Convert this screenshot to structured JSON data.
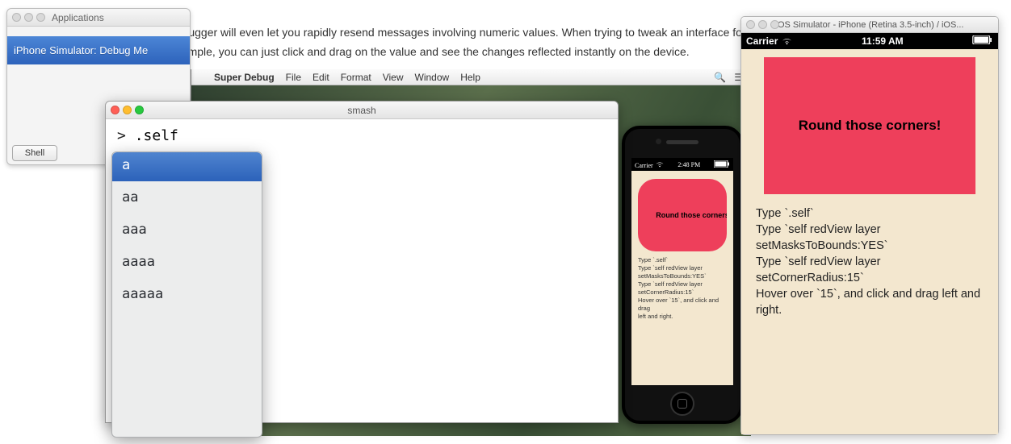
{
  "article": {
    "line1": "debugger will even let you rapidly resend messages involving numeric values. When trying to tweak an interface for",
    "line2": "example, you can just click and drag on the value and see the changes reflected instantly on the device."
  },
  "apps_window": {
    "title": "Applications",
    "selected_item": "iPhone Simulator: Debug Me",
    "shell_button": "Shell"
  },
  "mac_menubar": {
    "app": "Super Debug",
    "items": [
      "File",
      "Edit",
      "Format",
      "View",
      "Window",
      "Help"
    ]
  },
  "smash_window": {
    "title": "smash",
    "prompt_prefix": ">",
    "prompt_text": ".self"
  },
  "autocomplete": {
    "items": [
      "a",
      "aa",
      "aaa",
      "aaaa",
      "aaaaa"
    ]
  },
  "iphone_small": {
    "status_left": "Carrier",
    "status_center": "2:48 PM",
    "red_text": "Round those corners!",
    "instr": [
      "Type `.self`",
      "Type `self redView layer",
      "setMasksToBounds:YES`",
      "Type `self redView layer",
      "setCornerRadius:15`",
      "Hover over `15`, and click and drag",
      "left and right."
    ]
  },
  "simulator": {
    "title": "iOS Simulator - iPhone (Retina 3.5-inch) / iOS...",
    "status_left": "Carrier",
    "status_center": "11:59 AM",
    "red_text": "Round those corners!",
    "instr": [
      "Type `.self`",
      "Type `self redView layer setMasksToBounds:YES`",
      "Type `self redView layer setCornerRadius:15`",
      "Hover over `15`, and click and drag left and right."
    ]
  }
}
